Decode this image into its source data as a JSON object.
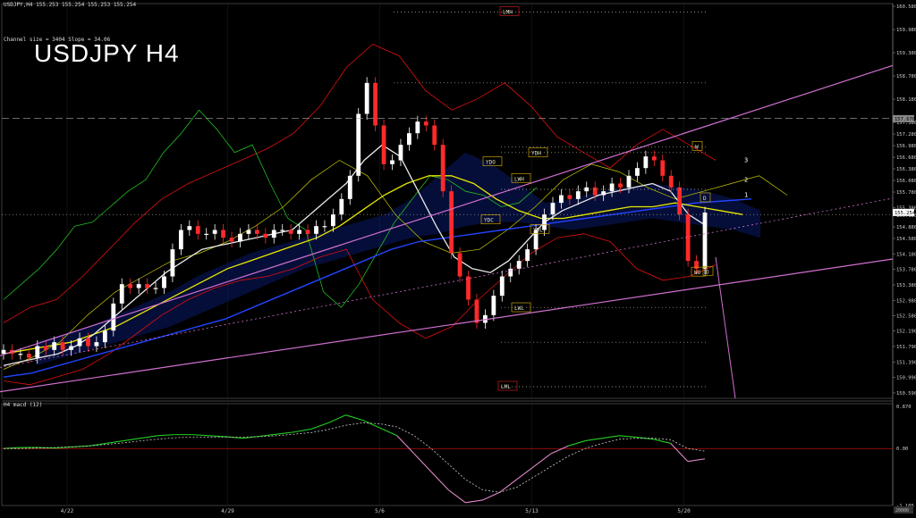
{
  "window": {
    "symbol_line": "USDJPY,H4  155.253 155.254 155.253 155.254",
    "channel_info": "Channel size = 3404 Slope = 34.06",
    "title": "USDJPY H4",
    "macd_title": "H4  macd (12)"
  },
  "colors": {
    "background": "#000000",
    "bull": "#ffffff",
    "bear": "#ff2a2a",
    "envelope": "#e01010",
    "ichimoku_upper": "#22bb22",
    "ichimoku_lower": "#c8c800",
    "ma_white": "#e8e8e8",
    "ma_yellow": "#e8e800",
    "ma_blue": "#2244ff",
    "channel": "#d070d0",
    "macd_main": "#20d020",
    "macd_neg": "#e088c8",
    "signal": "#cccccc",
    "hline": "#ffffff"
  },
  "chart_data": [
    {
      "type": "line",
      "title": "USDJPY H4",
      "price_axis_ticks": [
        "160.580",
        "159.980",
        "159.380",
        "158.780",
        "158.180",
        "157.580",
        "157.280",
        "156.980",
        "156.680",
        "156.380",
        "156.080",
        "155.780",
        "155.380",
        "155.180",
        "154.880",
        "154.580",
        "154.180",
        "153.780",
        "153.380",
        "152.980",
        "152.580",
        "152.190",
        "151.790",
        "151.390",
        "150.990",
        "150.590"
      ],
      "date_ticks": [
        "4/22",
        "4/29",
        "5/6",
        "5/13",
        "5/20"
      ],
      "ylim": [
        150.45,
        160.65
      ],
      "current_price": "155.254",
      "current_price_value": 155.254,
      "right_box_label": "157.676",
      "right_box_value": 157.676,
      "level_labels": [
        {
          "text": "LMH",
          "value": 160.43
        },
        {
          "text": "YDO",
          "value": 156.55
        },
        {
          "text": "YDH",
          "value": 156.78
        },
        {
          "text": "LWH",
          "value": 156.12
        },
        {
          "text": "YDC",
          "value": 155.05
        },
        {
          "text": "YDL",
          "value": 154.8
        },
        {
          "text": "LWL",
          "value": 152.78
        },
        {
          "text": "LML",
          "value": 150.75
        },
        {
          "text": "WO",
          "value": 153.7
        },
        {
          "text": "D",
          "value": 155.62
        },
        {
          "text": "D",
          "value": 153.72
        },
        {
          "text": "W",
          "value": 156.95
        }
      ],
      "channel_numbers": [
        {
          "text": "3",
          "value": 156.55
        },
        {
          "text": "2",
          "value": 156.05
        },
        {
          "text": "1",
          "value": 155.65
        }
      ],
      "series": [
        {
          "kind": "price_closes",
          "values": [
            151.7,
            151.6,
            151.6,
            151.5,
            151.8,
            151.7,
            151.9,
            151.7,
            151.8,
            152.0,
            151.8,
            151.9,
            152.2,
            152.9,
            153.4,
            153.3,
            153.4,
            153.3,
            153.3,
            153.6,
            154.3,
            154.8,
            154.9,
            154.7,
            154.7,
            154.8,
            154.6,
            154.5,
            154.7,
            154.8,
            154.7,
            154.6,
            154.8,
            154.8,
            154.7,
            154.8,
            154.7,
            154.9,
            154.9,
            155.2,
            155.6,
            156.2,
            157.8,
            158.6,
            157.5,
            156.5,
            156.6,
            157.0,
            157.3,
            157.6,
            157.5,
            157.0,
            155.8,
            154.2,
            153.6,
            153.0,
            152.4,
            152.6,
            153.1,
            153.6,
            153.8,
            154.0,
            154.3,
            154.8,
            155.2,
            155.5,
            155.7,
            155.6,
            155.8,
            155.9,
            155.7,
            155.8,
            156.0,
            155.9,
            156.2,
            156.4,
            156.7,
            156.6,
            156.2,
            155.9,
            155.2,
            154.0,
            153.8,
            155.25
          ]
        },
        {
          "kind": "ma_white",
          "values": [
            151.3,
            151.4,
            151.5,
            151.6,
            151.8,
            152.1,
            152.5,
            152.9,
            153.3,
            153.7,
            154.0,
            154.3,
            154.4,
            154.5,
            154.6,
            154.7,
            154.8,
            155.2,
            155.6,
            156.0,
            156.6,
            157.0,
            156.7,
            155.8,
            154.9,
            154.1,
            153.8,
            153.7,
            154.0,
            154.5,
            155.0,
            155.3,
            155.5,
            155.7,
            155.8,
            155.9,
            156.0,
            155.8,
            155.2,
            154.9
          ]
        },
        {
          "kind": "ma_yellow",
          "values": [
            151.6,
            151.7,
            151.8,
            151.9,
            152.1,
            152.3,
            152.6,
            152.9,
            153.2,
            153.5,
            153.8,
            154.0,
            154.2,
            154.4,
            154.6,
            154.9,
            155.3,
            155.7,
            156.0,
            156.2,
            156.2,
            156.0,
            155.6,
            155.3,
            155.1,
            155.1,
            155.2,
            155.3,
            155.4,
            155.4,
            155.5,
            155.4,
            155.3,
            155.2
          ]
        },
        {
          "kind": "ma_blue",
          "values": [
            151.0,
            151.1,
            151.3,
            151.5,
            151.7,
            151.9,
            152.1,
            152.3,
            152.5,
            152.8,
            153.1,
            153.4,
            153.7,
            154.0,
            154.3,
            154.5,
            154.6,
            154.7,
            154.8,
            154.9,
            155.0,
            155.1,
            155.2,
            155.3,
            155.4,
            155.5,
            155.55,
            155.6
          ]
        },
        {
          "kind": "macd_main",
          "values": [
            0.0,
            0.02,
            0.02,
            0.01,
            0.03,
            0.05,
            0.1,
            0.15,
            0.2,
            0.25,
            0.27,
            0.27,
            0.25,
            0.23,
            0.2,
            0.24,
            0.28,
            0.32,
            0.38,
            0.5,
            0.65,
            0.55,
            0.4,
            0.25,
            -0.1,
            -0.45,
            -0.8,
            -1.05,
            -1.0,
            -0.85,
            -0.6,
            -0.35,
            -0.1,
            0.05,
            0.15,
            0.2,
            0.25,
            0.22,
            0.18,
            0.1,
            -0.25,
            -0.2
          ]
        },
        {
          "kind": "macd_signal",
          "values": [
            0.0,
            0.0,
            0.01,
            0.02,
            0.03,
            0.05,
            0.08,
            0.11,
            0.15,
            0.18,
            0.21,
            0.22,
            0.22,
            0.22,
            0.22,
            0.23,
            0.25,
            0.28,
            0.31,
            0.37,
            0.45,
            0.5,
            0.48,
            0.42,
            0.25,
            0.0,
            -0.3,
            -0.6,
            -0.8,
            -0.85,
            -0.75,
            -0.55,
            -0.35,
            -0.15,
            0.0,
            0.1,
            0.18,
            0.2,
            0.2,
            0.17,
            0.0,
            -0.05
          ]
        }
      ]
    },
    {
      "type": "line",
      "title": "H4 macd (12)",
      "axis_ticks": [
        "0.870",
        "0.00",
        "-1.105"
      ],
      "ylim": [
        -1.105,
        0.87
      ]
    }
  ],
  "bottom_axis_box": "20000"
}
